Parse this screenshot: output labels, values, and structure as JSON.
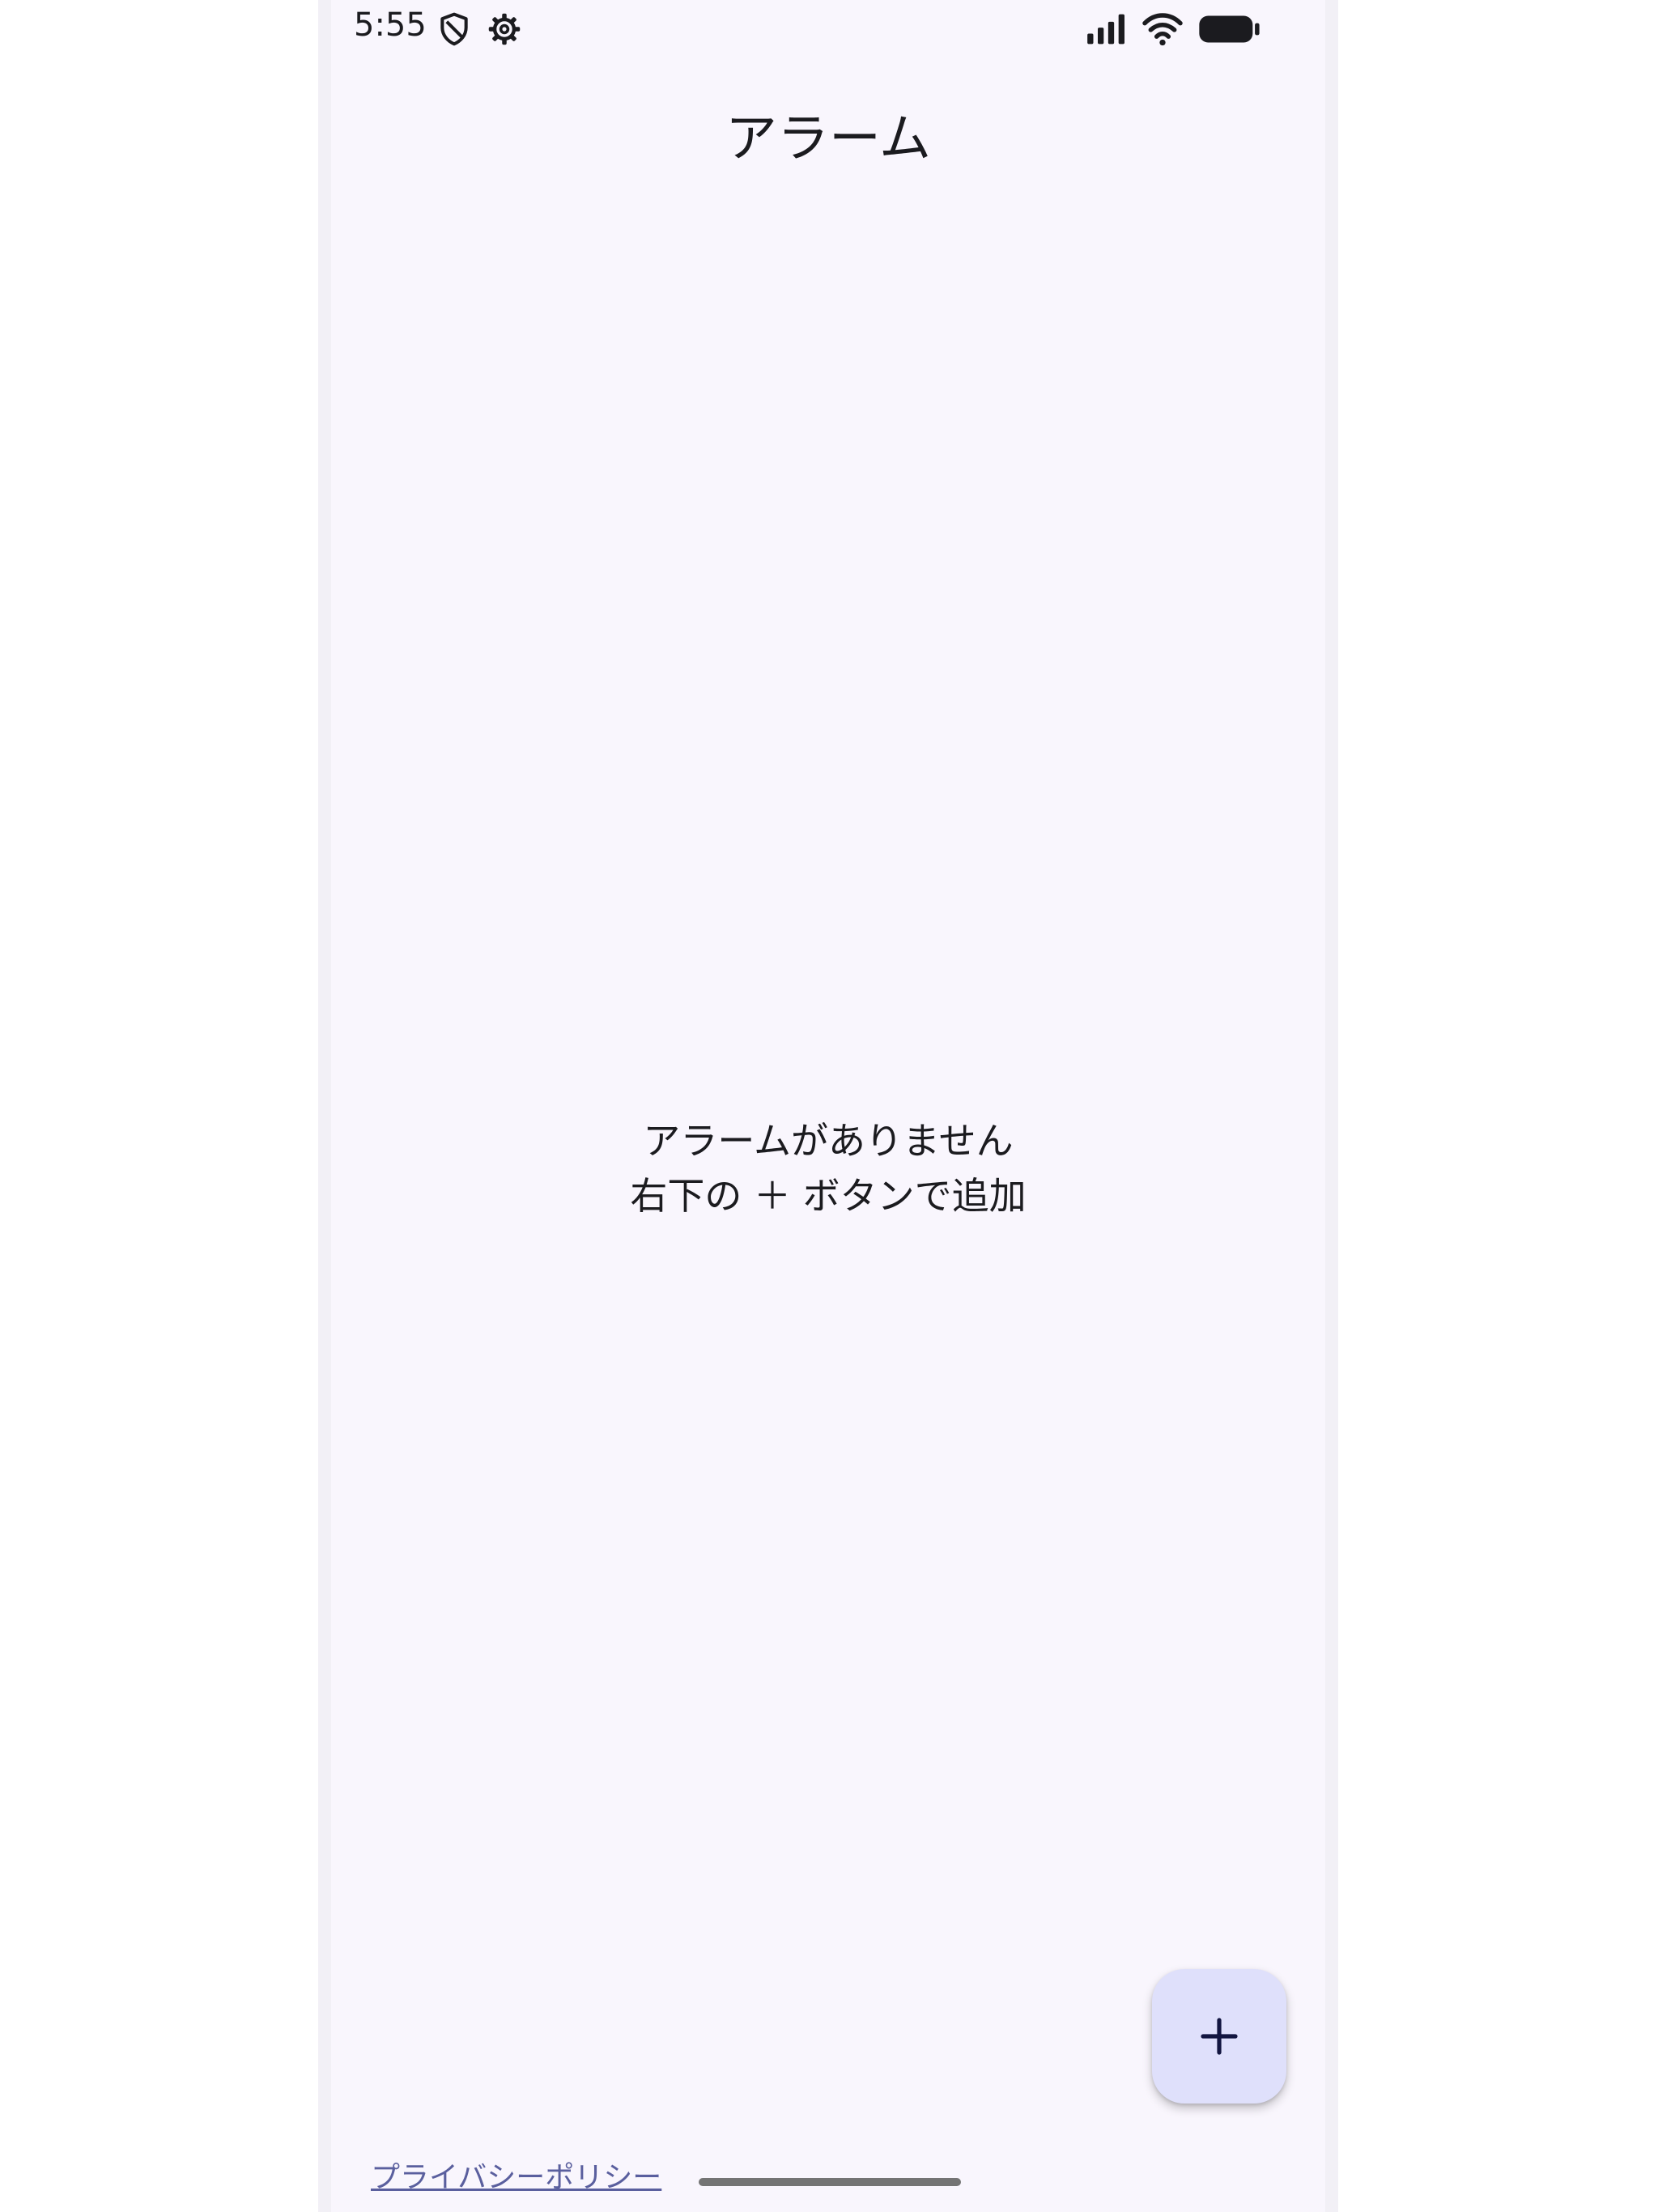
{
  "status_bar": {
    "time": "5:55",
    "left_icons": [
      "shield-icon",
      "gear-icon"
    ],
    "right_icons": [
      "signal-icon",
      "wifi-icon",
      "battery-icon"
    ]
  },
  "header": {
    "title": "アラーム"
  },
  "empty_state": {
    "line1": "アラームがありません",
    "line2": "右下の ＋ ボタンで追加"
  },
  "fab": {
    "icon": "plus-icon",
    "color": "#dfe0fb"
  },
  "footer": {
    "privacy_link": "プライバシーポリシー"
  },
  "colors": {
    "background": "#f9f6fd",
    "text": "#1b1b1f",
    "link": "#5a5f9e"
  }
}
